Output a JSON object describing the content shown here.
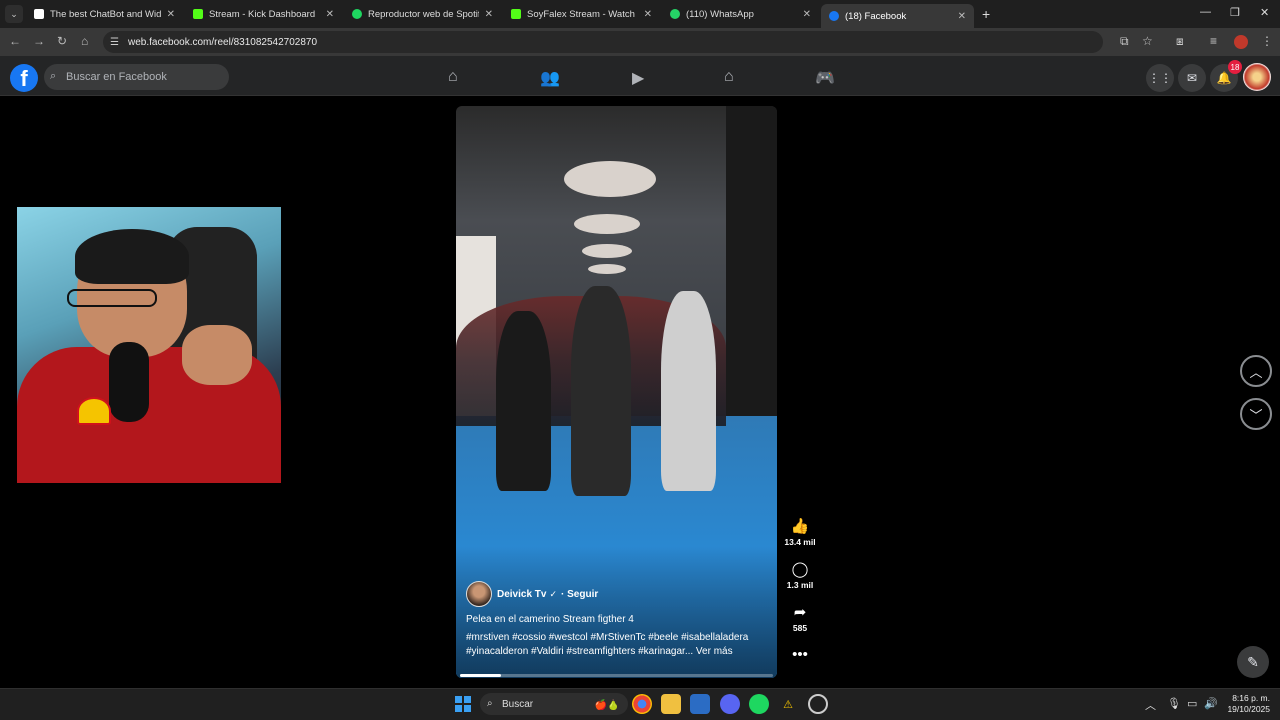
{
  "browser": {
    "tabs": [
      {
        "label": "The best ChatBot and Widgets",
        "color": "#ffffff"
      },
      {
        "label": "Stream - Kick Dashboard",
        "color": "#53fc18"
      },
      {
        "label": "Reproductor web de Spotify: m",
        "color": "#1ed760"
      },
      {
        "label": "SoyFalex Stream - Watch Live o",
        "color": "#53fc18"
      },
      {
        "label": "(110) WhatsApp",
        "color": "#25d366"
      },
      {
        "label": "(18) Facebook",
        "color": "#1877f2"
      }
    ],
    "url": "web.facebook.com/reel/831082542702870"
  },
  "facebook": {
    "logo": "f",
    "search_placeholder": "Buscar en Facebook",
    "notification_count": "18",
    "nav_icons": [
      "home-icon",
      "friends-icon",
      "video-icon",
      "marketplace-icon",
      "gaming-icon"
    ]
  },
  "reel": {
    "author": "Deivick Tv",
    "follow": "Seguir",
    "caption": "Pelea en el camerino Stream figther 4",
    "hashtags": "#mrstiven #cossio #westcol #MrStivenTc #beele #isabellaladera #yinacalderon #Valdiri #streamfighters #karinagar... Ver más",
    "likes": "13.4 mil",
    "comments": "1.3 mil",
    "shares": "585",
    "progress": 0.13
  },
  "taskbar": {
    "search": "Buscar",
    "time": "8:16 p. m.",
    "date": "19/10/2025"
  }
}
